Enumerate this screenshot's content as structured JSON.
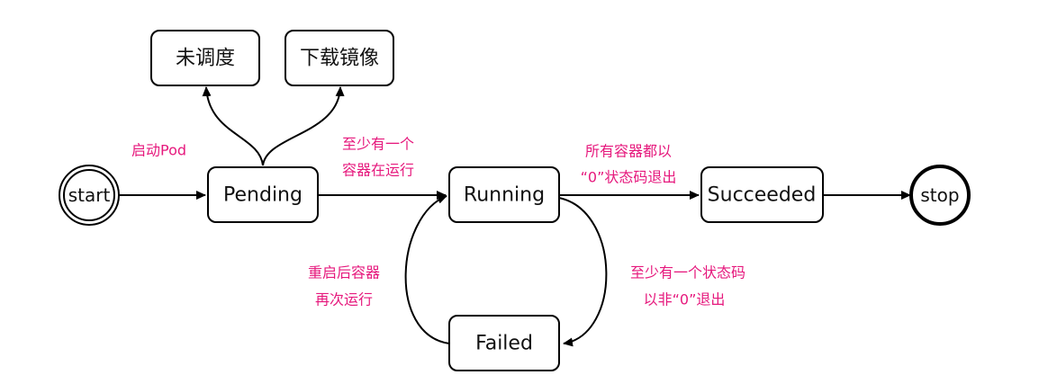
{
  "colors": {
    "label": "#e6197d",
    "line": "#000000",
    "node_fill": "#ffffff"
  },
  "nodes": {
    "start": "start",
    "pending": "Pending",
    "running": "Running",
    "succeeded": "Succeeded",
    "stop": "stop",
    "failed": "Failed",
    "unscheduled": "未调度",
    "pulling_image": "下载镜像"
  },
  "edge_labels": {
    "start_pod": "启动Pod",
    "pending_to_running_1": "至少有一个",
    "pending_to_running_2": "容器在运行",
    "running_to_succeeded_1": "所有容器都以",
    "running_to_succeeded_2": "“0”状态码退出",
    "running_to_failed_1": "至少有一个状态码",
    "running_to_failed_2": "以非“0”退出",
    "failed_to_running_1": "重启后容器",
    "failed_to_running_2": "再次运行"
  }
}
